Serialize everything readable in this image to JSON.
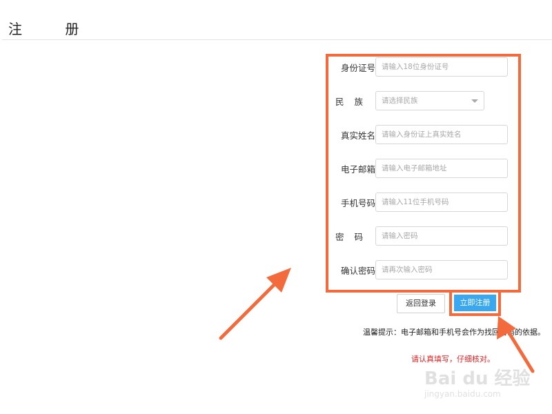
{
  "page": {
    "title": "注 册"
  },
  "form": {
    "fields": [
      {
        "label": "身份证号",
        "placeholder": "请输入18位身份证号"
      },
      {
        "label": "民族",
        "placeholder": "请选择民族"
      },
      {
        "label": "真实姓名",
        "placeholder": "请输入身份证上真实姓名"
      },
      {
        "label": "电子邮箱",
        "placeholder": "请输入电子邮箱地址"
      },
      {
        "label": "手机号码",
        "placeholder": "请输入11位手机号码"
      },
      {
        "label": "密码",
        "placeholder": "请输入密码"
      },
      {
        "label": "确认密码",
        "placeholder": "请再次输入密码"
      }
    ]
  },
  "actions": {
    "back_label": "返回登录",
    "register_label": "立即注册"
  },
  "notes": {
    "tip": "温馨提示：电子邮箱和手机号会作为找回密码的依据。",
    "warning": "请认真填写，仔细核对。"
  },
  "watermark": {
    "line1": "Bai du 经验",
    "line2": "jingyan.baidu.com"
  },
  "colors": {
    "highlight": "#f36b3c",
    "primary": "#39a8f0",
    "warning": "#e02020"
  }
}
